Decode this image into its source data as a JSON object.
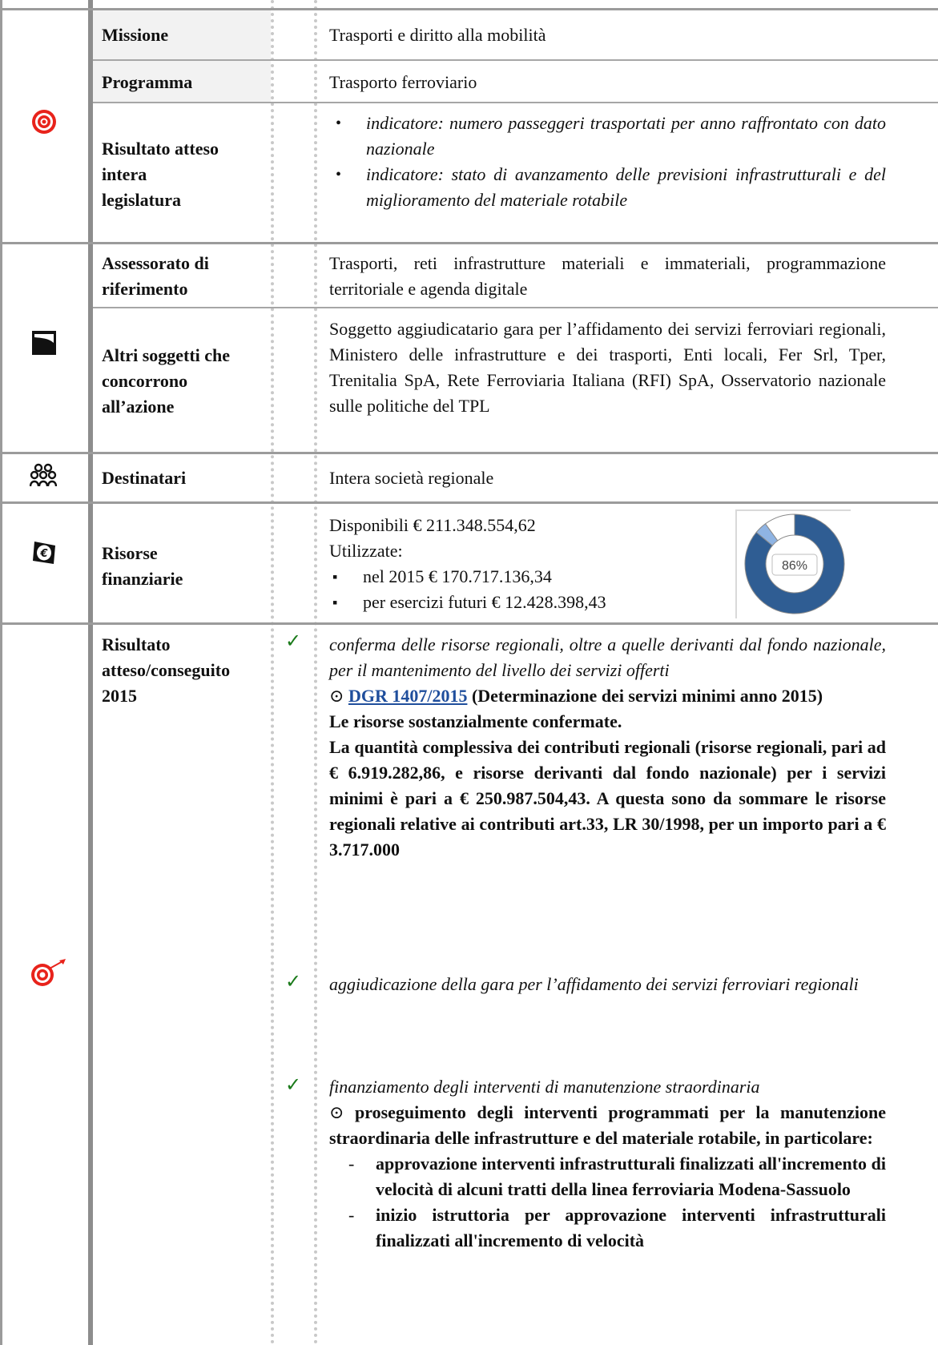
{
  "rows": {
    "missione": {
      "label": "Missione",
      "value": "Trasporti e diritto alla mobilità"
    },
    "programma": {
      "label": "Programma",
      "value": "Trasporto ferroviario"
    },
    "risultato_legislatura": {
      "label_lines": [
        "Risultato atteso",
        "intera",
        "legislatura"
      ],
      "items": [
        "indicatore: numero passeggeri trasportati per anno raffrontato con dato nazionale",
        "indicatore: stato di avanzamento delle previsioni infrastrutturali e del miglioramento del materiale rotabile"
      ]
    },
    "assessorato": {
      "label_lines": [
        "Assessorato di",
        "riferimento"
      ],
      "value": "Trasporti, reti infrastrutture materiali e immateriali, programmazione territoriale e agenda digitale"
    },
    "altri_soggetti": {
      "label_lines": [
        "Altri soggetti che",
        "concorrono",
        "all’azione"
      ],
      "value": "Soggetto aggiudicatario gara per l’affidamento dei servizi ferroviari regionali, Ministero delle infrastrutture e dei trasporti, Enti locali, Fer Srl, Tper, Trenitalia SpA, Rete Ferroviaria Italiana (RFI) SpA, Osservatorio nazionale sulle politiche del TPL"
    },
    "destinatari": {
      "label": "Destinatari",
      "value": "Intera società regionale"
    },
    "risorse": {
      "label_lines": [
        "Risorse",
        "finanziarie"
      ],
      "disponibili": "Disponibili € 211.348.554,62",
      "utilizzate": "Utilizzate:",
      "items": [
        "nel 2015 € 170.717.136,34",
        "per esercizi futuri € 12.428.398,43"
      ],
      "donut_label": "86%"
    },
    "risultato_2015": {
      "label_lines": [
        "Risultato",
        "atteso/conseguito",
        "2015"
      ],
      "item1_italic": "conferma delle risorse regionali, oltre a quelle derivanti dal fondo nazionale, per il mantenimento del livello dei servizi offerti",
      "item1_link": "DGR 1407/2015",
      "item1_link_suffix": " (Determinazione dei servizi minimi anno 2015)",
      "item1_bold_a": "Le risorse sostanzialmente confermate.",
      "item1_bold_b": "La quantità complessiva dei contributi regionali (risorse regionali, pari ad € 6.919.282,86, e risorse derivanti dal fondo nazionale) per i servizi minimi è pari a € 250.987.504,43. A questa sono da sommare le risorse regionali relative ai contributi art.33, LR 30/1998, per un importo pari a € 3.717.000",
      "item2_italic": "aggiudicazione della gara per l’affidamento dei servizi ferroviari regionali",
      "item3_italic": "finanziamento degli interventi di manutenzione straordinaria",
      "item3_bold": "proseguimento degli interventi programmati per la manutenzione straordinaria delle infrastrutture e del materiale rotabile, in particolare:",
      "item3_sub1": "approvazione interventi infrastrutturali finalizzati all'incremento di velocità di alcuni tratti della linea ferroviaria Modena-Sassuolo",
      "item3_sub2": "inizio istruttoria per approvazione interventi infrastrutturali finalizzati all'incremento di velocità"
    }
  },
  "chart_data": {
    "type": "pie",
    "values": [
      86,
      4,
      10
    ],
    "colors": [
      "#2f5d93",
      "#8fb4e3",
      "#ffffff"
    ],
    "center_label": "86%"
  },
  "colors": {
    "target_red": "#e8231b",
    "check_green": "#1a7a1a",
    "link_blue": "#1f4e9c",
    "donut_blue": "#2f5d93"
  }
}
